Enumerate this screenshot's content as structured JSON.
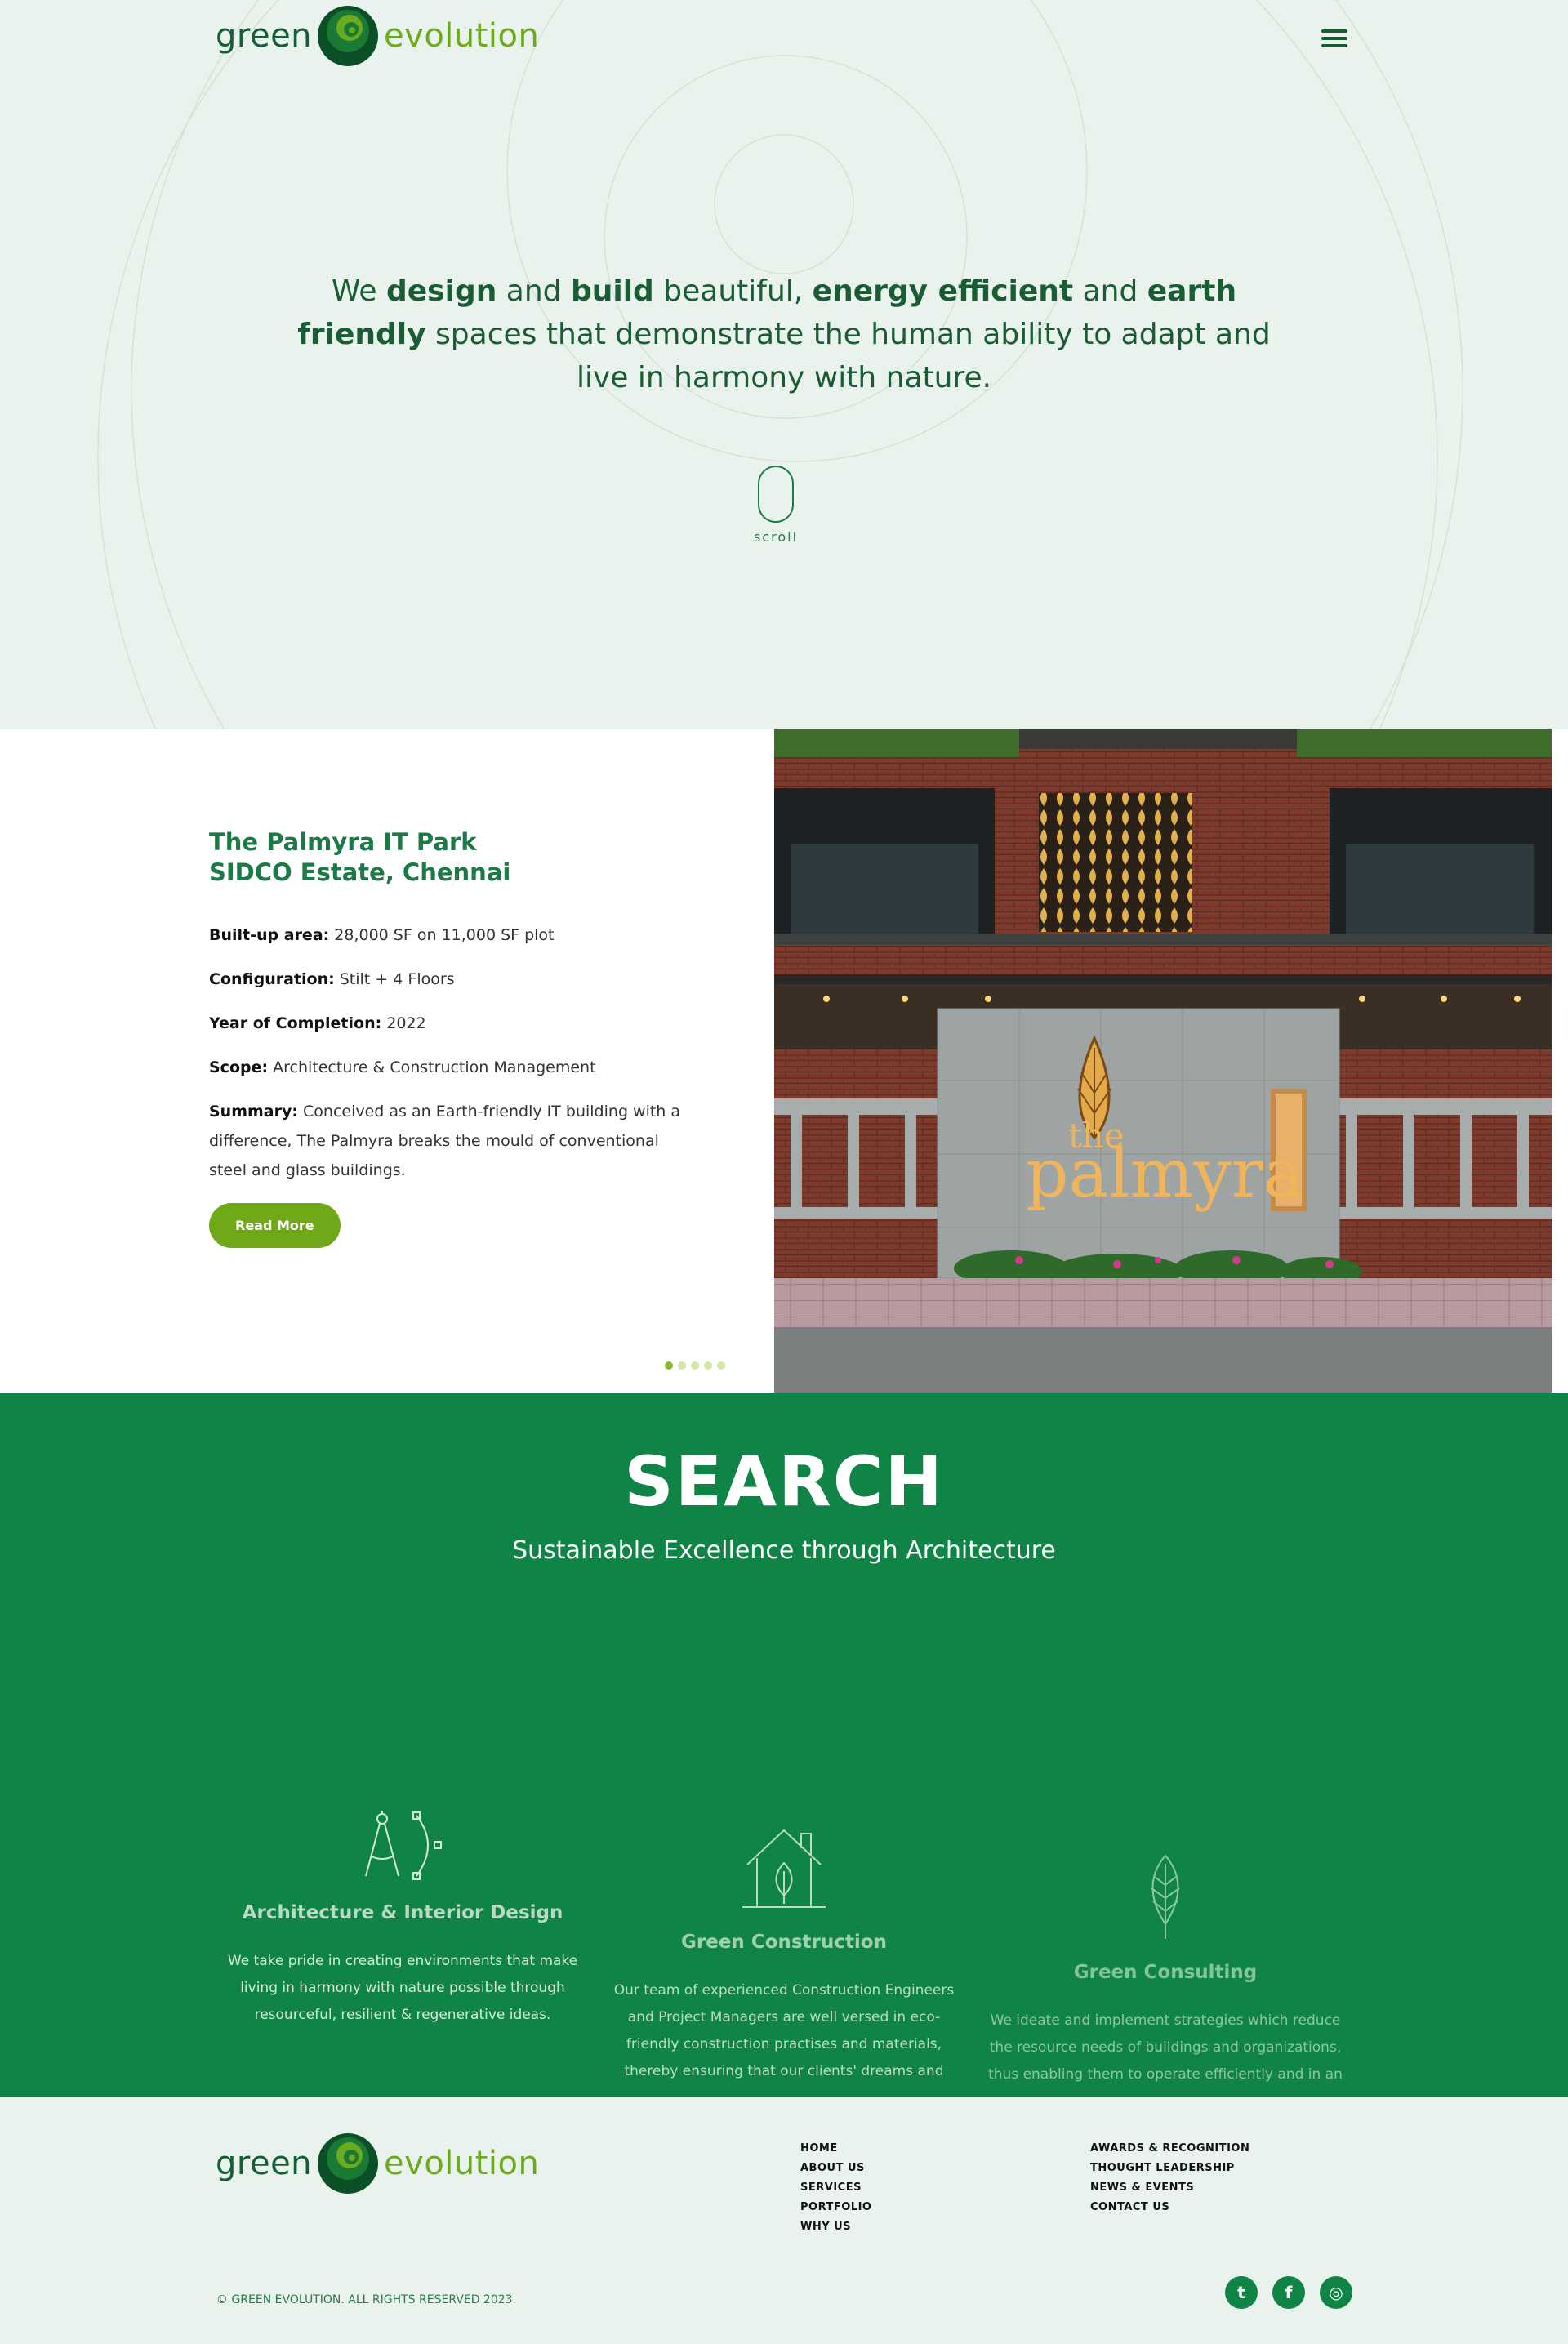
{
  "brand": {
    "word1": "green",
    "word2": "evolution"
  },
  "hero": {
    "t1": "We ",
    "b1": "design",
    "t2": " and ",
    "b2": "build",
    "t3": " beautiful, ",
    "b3": "energy efficient",
    "t4": " and ",
    "b4": "earth friendly",
    "t5": " spaces that demonstrate the human ability to adapt and live in harmony with nature.",
    "scroll_label": "scroll"
  },
  "project": {
    "title_line1": "The Palmyra IT Park",
    "title_line2": "SIDCO Estate, Chennai",
    "specs": [
      {
        "label": "Built-up area:",
        "value": " 28,000 SF on 11,000 SF plot"
      },
      {
        "label": "Configuration:",
        "value": " Stilt + 4 Floors"
      },
      {
        "label": "Year of Completion:",
        "value": " 2022"
      },
      {
        "label": "Scope:",
        "value": " Architecture & Construction Management"
      },
      {
        "label": "Summary:",
        "value": " Conceived as an Earth-friendly IT building with a difference, The Palmyra breaks the mould of conventional steel and glass buildings."
      }
    ],
    "read_more_label": "Read More",
    "sign_the": "the",
    "sign_name": "palmyra"
  },
  "search": {
    "heading": "SEARCH",
    "subheading": "Sustainable Excellence through Architecture",
    "services": [
      {
        "title": "Architecture & Interior Design",
        "description": "We take pride in creating environments that make living in harmony with nature possible through resourceful, resilient & regenerative ideas.",
        "icon": "compass-icon"
      },
      {
        "title": "Green Construction",
        "description": "Our team of experienced Construction Engineers and Project Managers are well versed in eco-friendly construction practises and materials, thereby ensuring that our clients' dreams and",
        "icon": "house-leaf-icon"
      },
      {
        "title": "Green Consulting",
        "description": "We ideate and implement strategies which reduce the resource needs of buildings and organizations, thus enabling them to operate efficiently and in an",
        "icon": "leaf-icon"
      }
    ]
  },
  "footer": {
    "col1": [
      "HOME",
      "ABOUT US",
      "SERVICES",
      "PORTFOLIO",
      "WHY US"
    ],
    "col2": [
      "AWARDS & RECOGNITION",
      "THOUGHT LEADERSHIP",
      "NEWS & EVENTS",
      "CONTACT US"
    ],
    "copyright": "© GREEN EVOLUTION. ALL RIGHTS RESERVED 2023.",
    "social": [
      {
        "icon": "twitter-icon",
        "glyph": "t"
      },
      {
        "icon": "facebook-icon",
        "glyph": "f"
      },
      {
        "icon": "instagram-icon",
        "glyph": "◎"
      }
    ]
  },
  "colors": {
    "primary_green": "#0f8446",
    "lime": "#6fa818",
    "dark_green": "#135f36",
    "mint_bg": "#e9f2ec"
  }
}
